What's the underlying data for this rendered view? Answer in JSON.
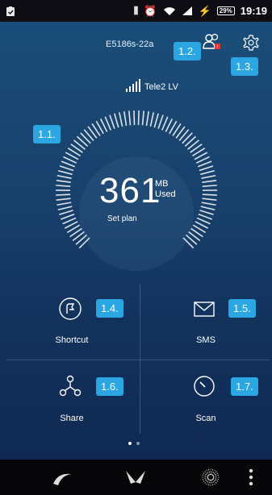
{
  "status_bar": {
    "battery": "29%",
    "time": "19:19"
  },
  "header": {
    "device_name": "E5186s-22a",
    "users_icon": "users-alert-icon",
    "settings_icon": "gear-icon"
  },
  "carrier": {
    "name": "Tele2 LV"
  },
  "usage": {
    "value": "361",
    "unit_top": "MB",
    "unit_bottom": "Used",
    "set_plan_label": "Set plan"
  },
  "tiles": {
    "shortcut": {
      "label": "Shortcut",
      "icon": "shortcut-icon"
    },
    "sms": {
      "label": "SMS",
      "icon": "envelope-icon"
    },
    "share": {
      "label": "Share",
      "icon": "share-icon"
    },
    "scan": {
      "label": "Scan",
      "icon": "scan-icon"
    }
  },
  "callouts": {
    "c11": "1.1.",
    "c12": "1.2.",
    "c13": "1.3.",
    "c14": "1.4.",
    "c15": "1.5.",
    "c16": "1.6.",
    "c17": "1.7."
  },
  "pager": {
    "pages": 2,
    "current": 1
  },
  "colors": {
    "callout": "#2aa6e3",
    "background_top": "#1a4f7c",
    "background_bottom": "#0e2750"
  }
}
